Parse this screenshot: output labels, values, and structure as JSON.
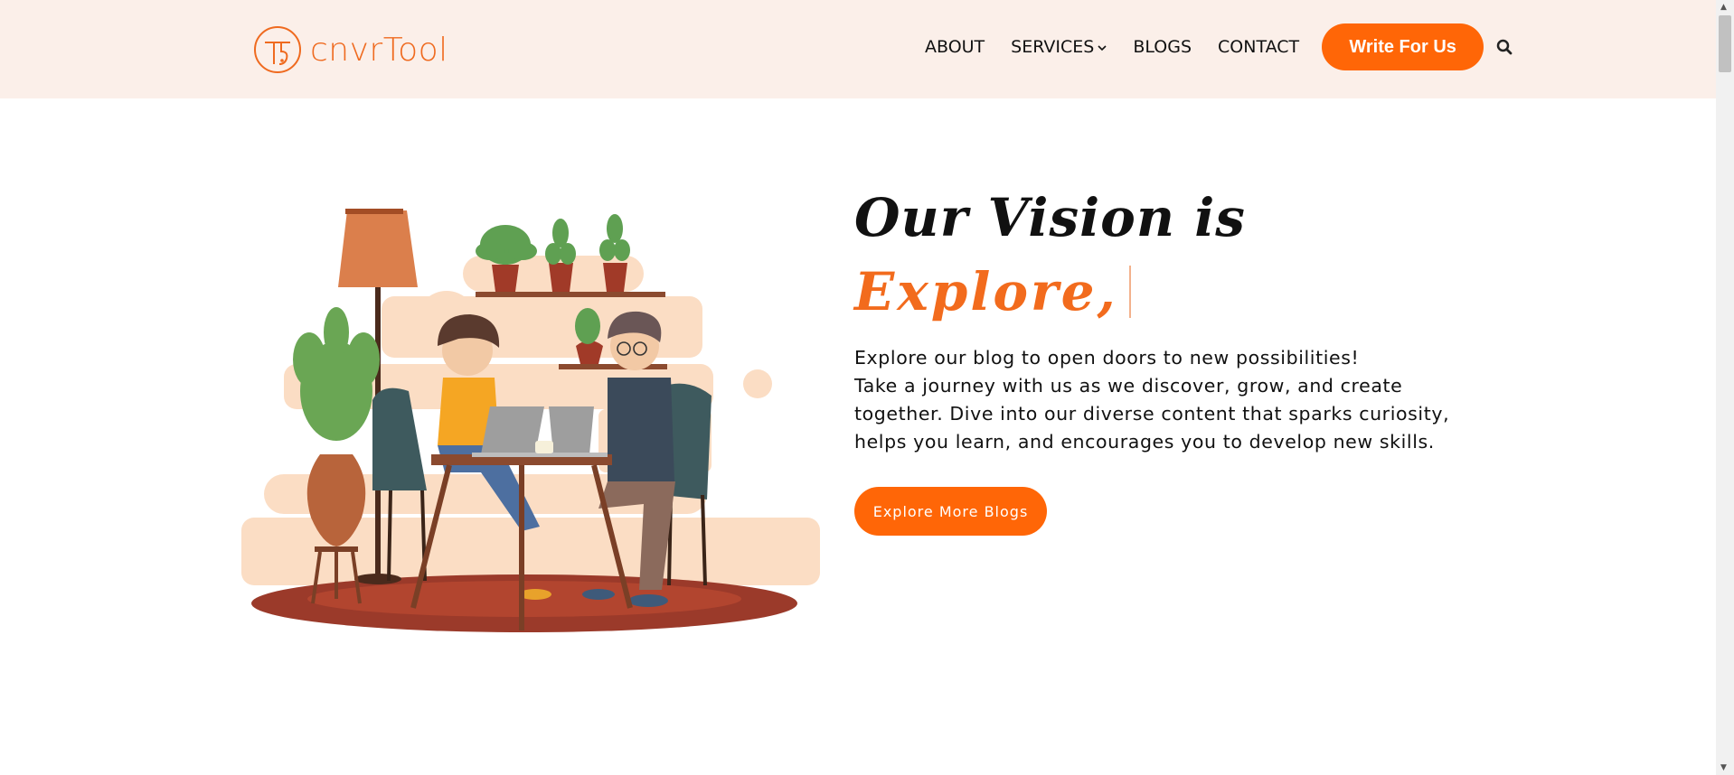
{
  "brand": {
    "name": "cnvrTool",
    "accent_color": "#ff6607",
    "header_bg": "#fbefe9"
  },
  "nav": {
    "items": [
      {
        "label": "ABOUT"
      },
      {
        "label": "SERVICES",
        "icon": "chevron-down-icon"
      },
      {
        "label": "BLOGS"
      },
      {
        "label": "CONTACT"
      }
    ],
    "cta_label": "Write For Us",
    "search_icon": "search-icon"
  },
  "hero": {
    "title": "Our Vision is",
    "rotating_word": "Explore,",
    "description_lines": [
      "Explore our blog to open doors to new possibilities!",
      "Take a journey with us as we discover, grow, and create",
      "together. Dive into our diverse content that sparks curiosity,",
      "helps you learn, and encourages you to develop new skills."
    ],
    "cta_label": "Explore More Blogs",
    "illustration": "two-people-working-at-table-illustration"
  }
}
